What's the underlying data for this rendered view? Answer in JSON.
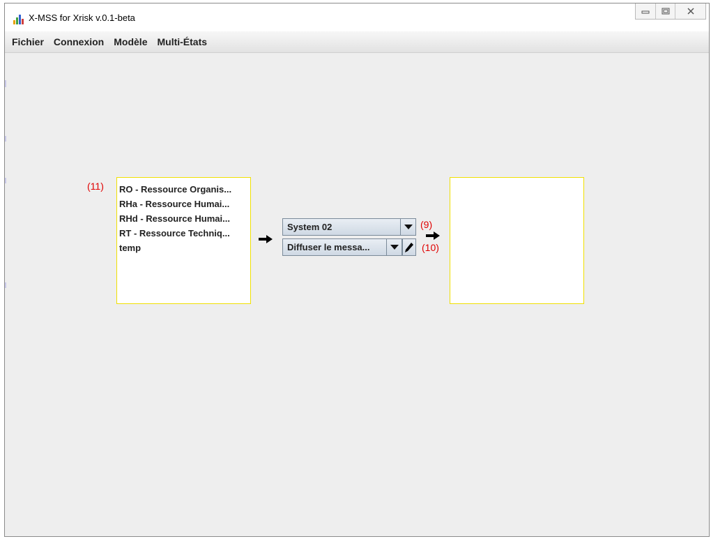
{
  "window": {
    "title": "X-MSS for Xrisk v.0.1-beta"
  },
  "menu": [
    "Fichier",
    "Connexion",
    "Modèle",
    "Multi-États"
  ],
  "left_panel": {
    "label": "(11)",
    "items": [
      "RO - Ressource Organis...",
      "RHa - Ressource Humai...",
      "RHd - Ressource Humai...",
      "RT - Ressource Techniq...",
      "temp"
    ]
  },
  "system_select": {
    "value": "System 02",
    "label": "(9)"
  },
  "action_select": {
    "value": "Diffuser le messa...",
    "label": "(10)"
  },
  "colors": {
    "panel_border": "#f0e000",
    "annotation": "#e00000"
  }
}
